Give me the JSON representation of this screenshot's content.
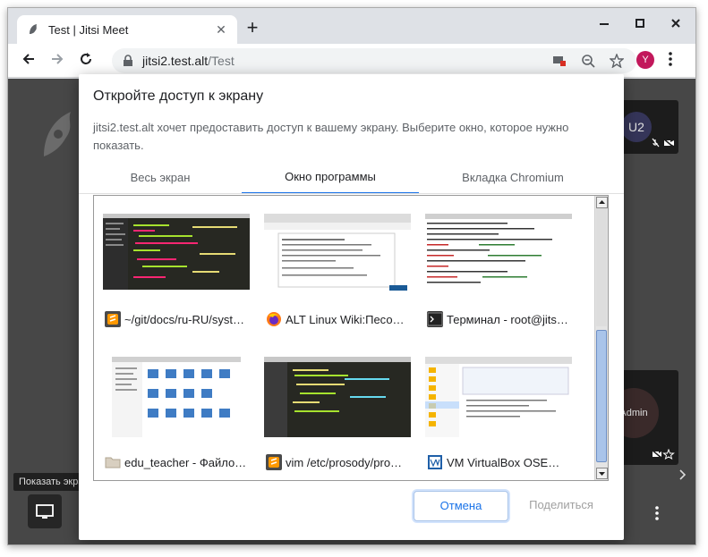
{
  "browser": {
    "tab_title": "Test | Jitsi Meet",
    "tab_close": "✕",
    "new_tab": "+",
    "url_host": "jitsi2.test.alt",
    "url_path": "/Test",
    "profile_initial": "Y"
  },
  "page": {
    "participants": [
      {
        "initials": "U2"
      },
      {
        "initials": "Admin"
      }
    ],
    "tooltip": "Показать экран"
  },
  "dialog": {
    "title": "Откройте доступ к экрану",
    "description": "jitsi2.test.alt хочет предоставить доступ к вашему экрану. Выберите окно, которое нужно показать.",
    "tabs": [
      {
        "label": "Весь экран",
        "active": false
      },
      {
        "label": "Окно программы",
        "active": true
      },
      {
        "label": "Вкладка Chromium",
        "active": false
      }
    ],
    "windows": [
      {
        "label": "~/git/docs/ru-RU/syst…",
        "icon": "sublime-text-icon",
        "thumb": "dark-editor"
      },
      {
        "label": "ALT Linux Wiki:Песо…",
        "icon": "firefox-icon",
        "thumb": "light-web"
      },
      {
        "label": "Терминал - root@jits…",
        "icon": "terminal-icon",
        "thumb": "terminal"
      },
      {
        "label": "edu_teacher - Файло…",
        "icon": "folder-icon",
        "thumb": "file-manager"
      },
      {
        "label": "vim /etc/prosody/pro…",
        "icon": "sublime-text-icon",
        "thumb": "dark-editor"
      },
      {
        "label": "VM VirtualBox OSE…",
        "icon": "virtualbox-icon",
        "thumb": "virtualbox"
      }
    ],
    "cancel_label": "Отмена",
    "share_label": "Поделиться"
  },
  "colors": {
    "accent": "#1a73e8",
    "page_bg": "#474747",
    "profile": "#c2185b"
  }
}
